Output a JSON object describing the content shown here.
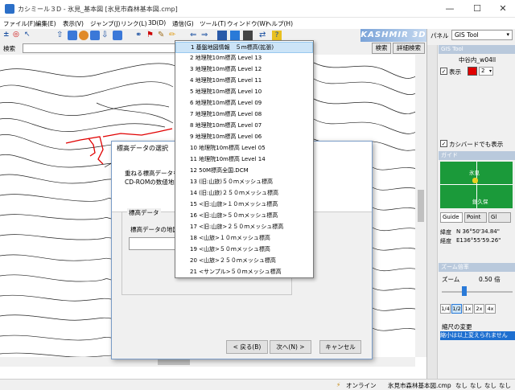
{
  "window": {
    "title": "カシミール３D - 氷見_基本図 [氷見市森林基本図.cmp]",
    "minimize": "—",
    "maximize": "☐",
    "close": "✕"
  },
  "menu": [
    "ファイル(F)",
    "編集(E)",
    "表示(V)",
    "ジャンプ(J)",
    "リンク(L)",
    "3D(D)",
    "通信(G)",
    "ツール(T)",
    "ウィンドウ(W)",
    "ヘルプ(H)"
  ],
  "brand": "KASHMIR 3D",
  "search": {
    "label": "検索",
    "button": "検索",
    "detail_button": "詳細検索"
  },
  "panel": {
    "label": "パネル",
    "selected": "GIS Tool"
  },
  "gis": {
    "header": "GIS Tool",
    "layer_name": "中谷内_w04ll",
    "show_label": "表示",
    "color": "#e00000",
    "line_width": "2",
    "kashbird_label": "カシバードでも表示"
  },
  "guide": {
    "header": "ガイド",
    "place_top": "氷見",
    "place_bottom": "銀久保",
    "tabs": [
      "Guide",
      "Point",
      "Gl"
    ],
    "lat_label": "緯度",
    "lat": "N 36°50'34.84\"",
    "lon_label": "経度",
    "lon": "E136°55'59.26\""
  },
  "zoom": {
    "header": "ズーム倍率",
    "label": "ズーム",
    "value": "0.50 倍",
    "level": 0.3,
    "presets": [
      "1/4",
      "1/2",
      "1x",
      "2x",
      "4x"
    ]
  },
  "scale": {
    "label": "縮尺の変更",
    "highlight": "縮小は以上変えられません"
  },
  "dialog": {
    "title": "標高データの選択",
    "line1": "重ねる標高データを選択",
    "line2": "CD-ROMの数値地図",
    "group_label": "標高データ",
    "map_label": "標高データの地図",
    "back": "< 戻る(B)",
    "next": "次へ(N) >",
    "cancel": "キャンセル"
  },
  "dropdown": {
    "selected_index": 0,
    "items": [
      "1 基盤地図情報　５ｍ標高(拡張)",
      "2 地理院10m標高 Level 13",
      "3 地理院10m標高 Level 12",
      "4 地理院10m標高 Level 11",
      "5 地理院10m標高 Level 10",
      "6 地理院10m標高 Level 09",
      "7 地理院10m標高 Level 08",
      "8 地理院10m標高 Level 07",
      "9 地理院10m標高 Level 06",
      "10 地理院10m標高 Level 05",
      "11 地理院10m標高 Level 14",
      "12 50M標高全国.DCM",
      "13 (旧:山旅)５０ｍメッシュ標高",
      "14 (旧:山旅)２５０ｍメッシュ標高",
      "15 <旧:山旅>１０ｍメッシュ標高",
      "16 <旧:山旅>５０ｍメッシュ標高",
      "17 <旧:山旅>２５０ｍメッシュ標高",
      "18 <山旅>１０ｍメッシュ標高",
      "19 <山旅>５０ｍメッシュ標高",
      "20 <山旅>２５０ｍメッシュ標高",
      "21 <サンプル>５０ｍメッシュ標高"
    ]
  },
  "status": {
    "online": "オンライン",
    "file": "氷見市森林基本図.cmp",
    "s1": "なし",
    "s2": "なし",
    "s3": "なし",
    "s4": "なし"
  }
}
